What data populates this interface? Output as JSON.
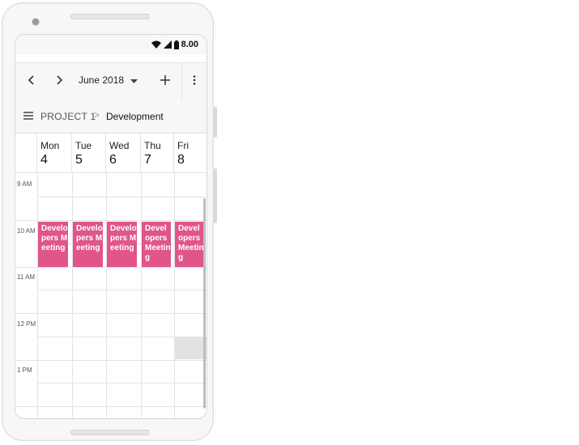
{
  "statusbar": {
    "time": "8.00"
  },
  "toolbar": {
    "month_label": "June 2018"
  },
  "breadcrumb": {
    "project": "PROJECT 1",
    "separator": ">",
    "current": "Development"
  },
  "days": [
    {
      "name": "Mon",
      "date": "4"
    },
    {
      "name": "Tue",
      "date": "5"
    },
    {
      "name": "Wed",
      "date": "6"
    },
    {
      "name": "Thu",
      "date": "7"
    },
    {
      "name": "Fri",
      "date": "8"
    }
  ],
  "time_labels": [
    "9 AM",
    "10 AM",
    "11 AM",
    "12 PM",
    "1 PM"
  ],
  "events": [
    {
      "title": "Developers Meeting",
      "day": 0
    },
    {
      "title": "Developers Meeting",
      "day": 1
    },
    {
      "title": "Developers Meeting",
      "day": 2
    },
    {
      "title": "Developers Meeting",
      "day": 3
    },
    {
      "title": "Developers Meeting",
      "day": 4
    }
  ],
  "colors": {
    "event": "#e0558a",
    "accent_bg": "#f7f7f7"
  },
  "icons": [
    "wifi-icon",
    "signal-icon",
    "battery-icon",
    "chevron-left-icon",
    "chevron-right-icon",
    "dropdown-icon",
    "add-icon",
    "more-vert-icon",
    "menu-icon"
  ]
}
